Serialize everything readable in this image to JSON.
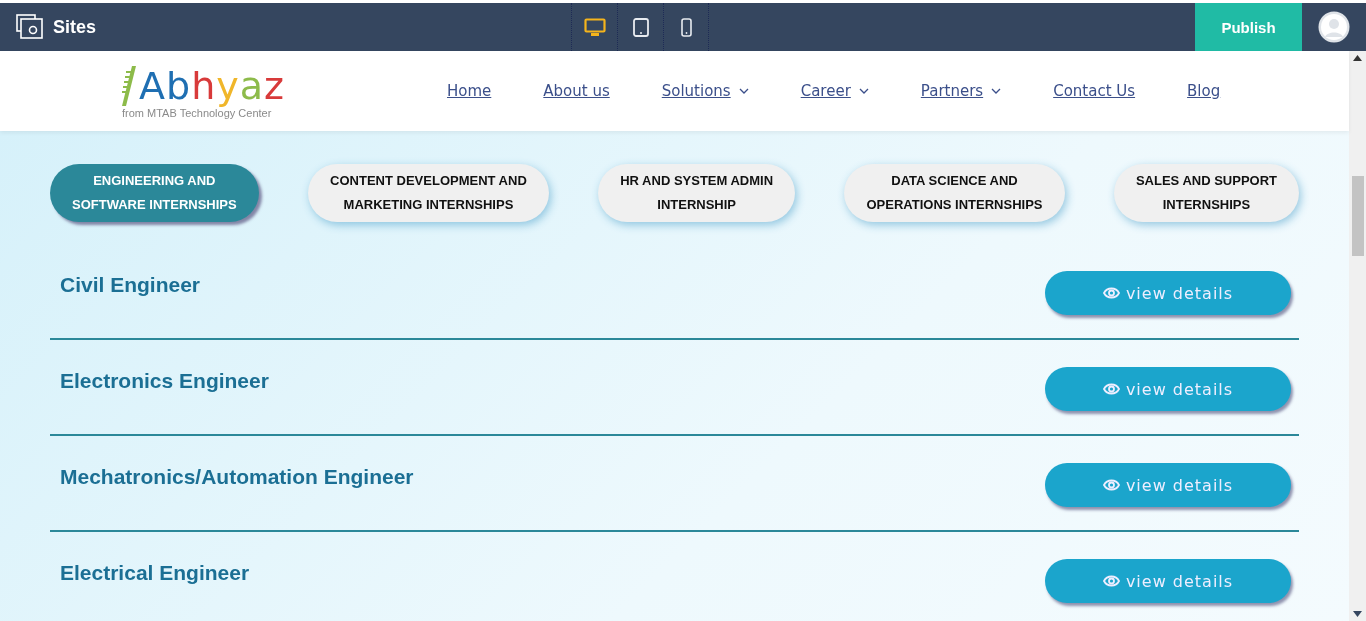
{
  "app_bar": {
    "title": "Sites",
    "devices": [
      {
        "kind": "desktop",
        "selected": true
      },
      {
        "kind": "tablet",
        "selected": false
      },
      {
        "kind": "phone",
        "selected": false
      }
    ],
    "publish": "Publish"
  },
  "site_header": {
    "logo": {
      "name": "Abhyaz",
      "tagline": "from MTAB Technology Center"
    },
    "nav": [
      {
        "label": "Home",
        "dropdown": false
      },
      {
        "label": "About us",
        "dropdown": false
      },
      {
        "label": "Solutions",
        "dropdown": true
      },
      {
        "label": "Career",
        "dropdown": true
      },
      {
        "label": "Partners",
        "dropdown": true
      },
      {
        "label": "Contact Us",
        "dropdown": false
      },
      {
        "label": "Blog",
        "dropdown": false
      }
    ]
  },
  "tabs": [
    {
      "lines": [
        "ENGINEERING AND",
        "SOFTWARE INTERNSHIPS"
      ],
      "selected": true
    },
    {
      "lines": [
        "CONTENT DEVELOPMENT AND",
        "MARKETING INTERNSHIPS"
      ],
      "selected": false
    },
    {
      "lines": [
        "HR AND SYSTEM ADMIN",
        "INTERNSHIP"
      ],
      "selected": false
    },
    {
      "lines": [
        "DATA SCIENCE AND",
        "OPERATIONS INTERNSHIPS"
      ],
      "selected": false
    },
    {
      "lines": [
        "SALES AND SUPPORT",
        "INTERNSHIPS"
      ],
      "selected": false
    }
  ],
  "positions": [
    {
      "title": "Civil Engineer",
      "button": "view details"
    },
    {
      "title": "Electronics Engineer",
      "button": "view details"
    },
    {
      "title": "Mechatronics/Automation Engineer",
      "button": "view details"
    },
    {
      "title": "Electrical Engineer",
      "button": "view details"
    }
  ]
}
